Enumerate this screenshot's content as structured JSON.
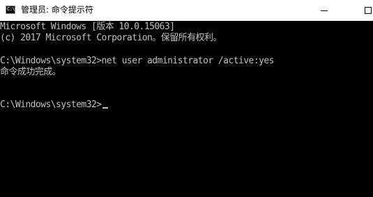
{
  "window": {
    "app_icon": "cmd-icon",
    "app_icon_text": "C:\\",
    "title": "管理员: 命令提示符",
    "controls": {
      "minimize_icon": "minimize-icon",
      "maximize_icon": "maximize-icon"
    }
  },
  "console": {
    "lines": [
      "Microsoft Windows [版本 10.0.15063]",
      "(c) 2017 Microsoft Corporation。保留所有权利。",
      "",
      "C:\\Windows\\system32>net user administrator /active:yes",
      "命令成功完成。",
      "",
      "C:\\Windows\\system32>"
    ]
  },
  "colors": {
    "console_background": "#000000",
    "console_text": "#c0c0c0",
    "titlebar_background": "#ffffff"
  }
}
